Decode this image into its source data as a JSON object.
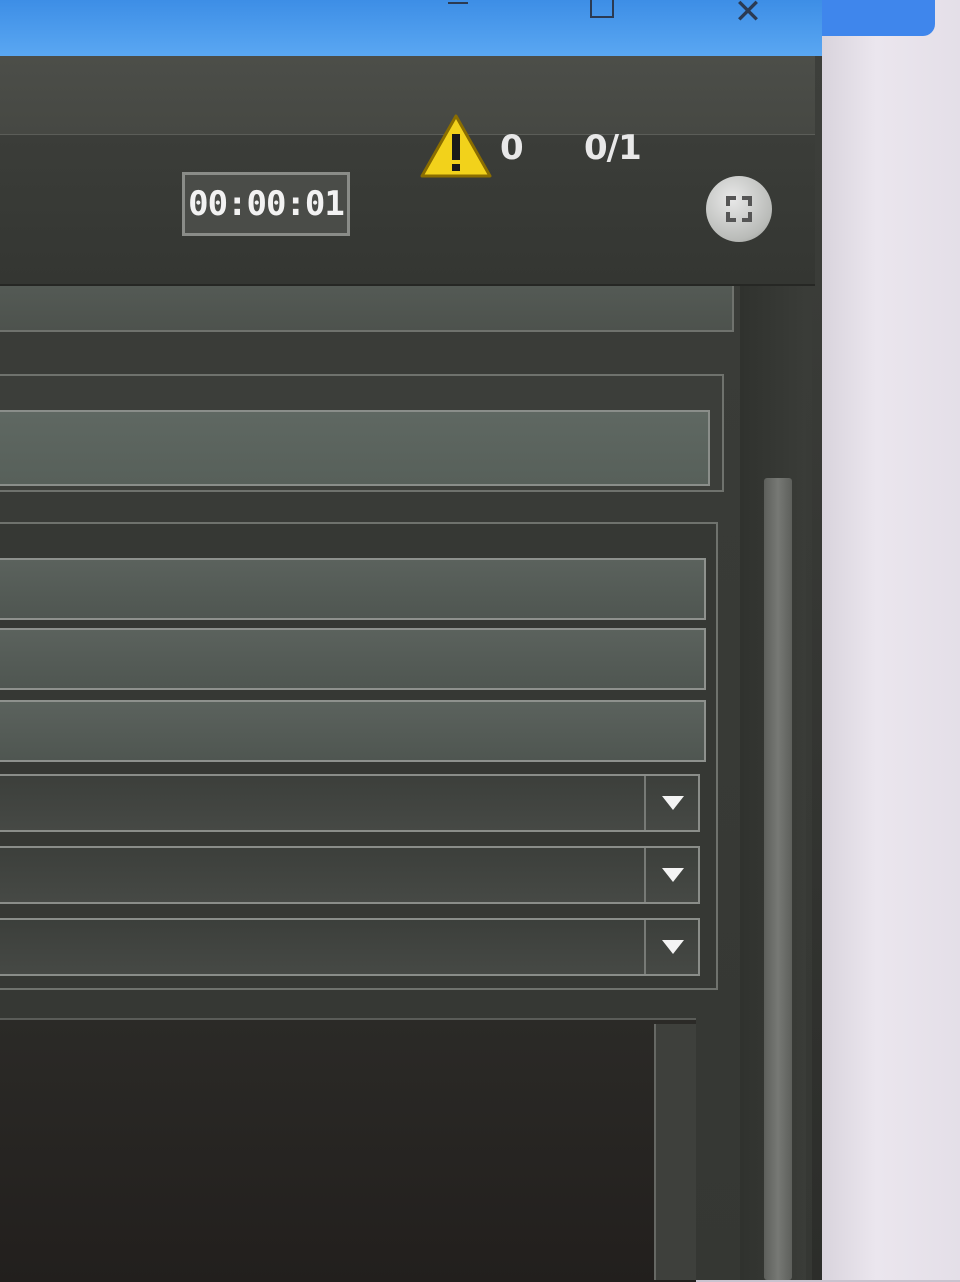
{
  "window": {
    "minimize_glyph": "",
    "maximize_glyph": "",
    "close_glyph": "✕"
  },
  "toolbar": {
    "timer": "00:00:01",
    "warning_icon": "warning-triangle-icon",
    "warning_count": "0",
    "progress_ratio": "0/1",
    "fullscreen_icon": "fullscreen-icon"
  },
  "colors": {
    "title_bar": "#4a9aec",
    "app_background": "#3a3c38",
    "warning_yellow": "#f2d21b"
  }
}
